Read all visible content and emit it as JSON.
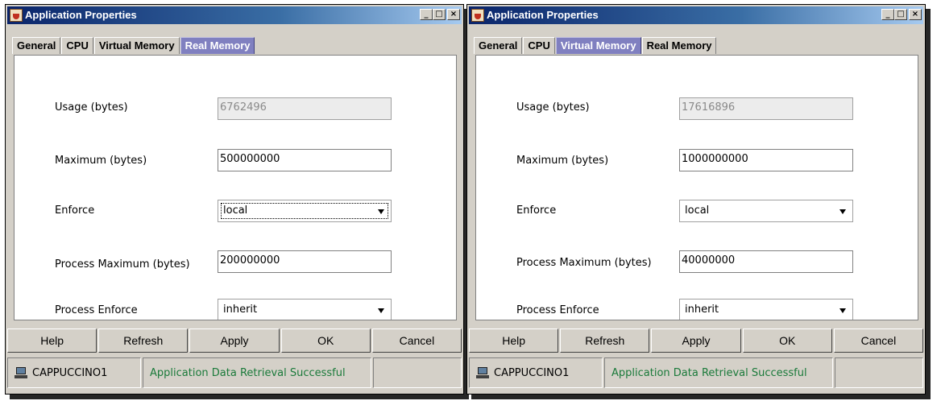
{
  "windows": [
    {
      "title": "Application Properties",
      "tabs": [
        "General",
        "CPU",
        "Virtual Memory",
        "Real Memory"
      ],
      "active_tab": "Real Memory",
      "fields": {
        "usage_label": "Usage (bytes)",
        "usage_value": "6762496",
        "maximum_label": "Maximum (bytes)",
        "maximum_value": "500000000",
        "enforce_label": "Enforce",
        "enforce_value": "local",
        "process_maximum_label": "Process Maximum (bytes)",
        "process_maximum_value": "200000000",
        "process_enforce_label": "Process Enforce",
        "process_enforce_value": "inherit"
      },
      "buttons": {
        "help": "Help",
        "refresh": "Refresh",
        "apply": "Apply",
        "ok": "OK",
        "cancel": "Cancel"
      },
      "status": {
        "host": "CAPPUCCINO1",
        "message": "Application Data Retrieval Successful"
      }
    },
    {
      "title": "Application Properties",
      "tabs": [
        "General",
        "CPU",
        "Virtual Memory",
        "Real Memory"
      ],
      "active_tab": "Virtual Memory",
      "fields": {
        "usage_label": "Usage (bytes)",
        "usage_value": "17616896",
        "maximum_label": "Maximum (bytes)",
        "maximum_value": "1000000000",
        "enforce_label": "Enforce",
        "enforce_value": "local",
        "process_maximum_label": "Process Maximum (bytes)",
        "process_maximum_value": "40000000",
        "process_enforce_label": "Process Enforce",
        "process_enforce_value": "inherit"
      },
      "buttons": {
        "help": "Help",
        "refresh": "Refresh",
        "apply": "Apply",
        "ok": "OK",
        "cancel": "Cancel"
      },
      "status": {
        "host": "CAPPUCCINO1",
        "message": "Application Data Retrieval Successful"
      }
    }
  ],
  "colors": {
    "titlebar_start": "#0a246a",
    "active_tab": "#8080c0",
    "status_message": "#1a7a3a",
    "window_bg": "#d4d0c8"
  },
  "icons": {
    "app_icon": "java-cup-icon",
    "window_controls": [
      "minimize-icon",
      "maximize-icon",
      "close-icon"
    ],
    "combo_arrow": "chevron-down-icon",
    "status_host": "computer-icon"
  }
}
